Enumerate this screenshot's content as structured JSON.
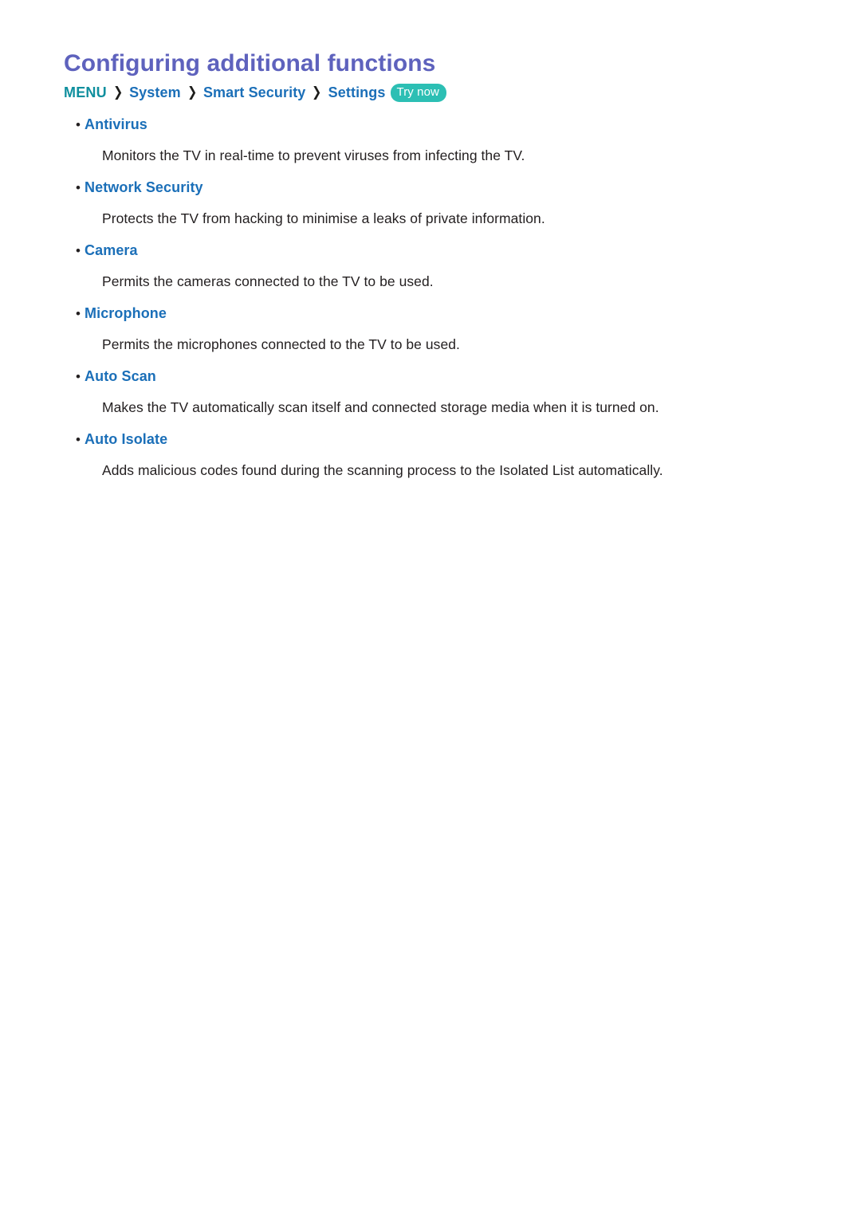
{
  "page": {
    "title": "Configuring additional functions"
  },
  "breadcrumb": {
    "root": "MENU",
    "separator": "❯",
    "items": [
      {
        "label": "System"
      },
      {
        "label": "Smart Security"
      },
      {
        "label": "Settings"
      }
    ],
    "badge": "Try now"
  },
  "colors": {
    "title": "#5e62bd",
    "breadcrumb_root": "#0f8f9e",
    "breadcrumb_link": "#1b6fb8",
    "badge_bg": "#2cbfb4",
    "badge_text": "#ffffff",
    "body_text": "#231f20",
    "background": "#ffffff"
  },
  "features": [
    {
      "bullet": "•",
      "label": "Antivirus",
      "description": "Monitors the TV in real-time to prevent viruses from infecting the TV."
    },
    {
      "bullet": "•",
      "label": "Network Security",
      "description": "Protects the TV from hacking to minimise a leaks of private information."
    },
    {
      "bullet": "•",
      "label": "Camera",
      "description": "Permits the cameras connected to the TV to be used."
    },
    {
      "bullet": "•",
      "label": "Microphone",
      "description": "Permits the microphones connected to the TV to be used."
    },
    {
      "bullet": "•",
      "label": "Auto Scan",
      "description": "Makes the TV automatically scan itself and connected storage media when it is turned on."
    },
    {
      "bullet": "•",
      "label": "Auto Isolate",
      "description": "Adds malicious codes found during the scanning process to the Isolated List automatically."
    }
  ]
}
